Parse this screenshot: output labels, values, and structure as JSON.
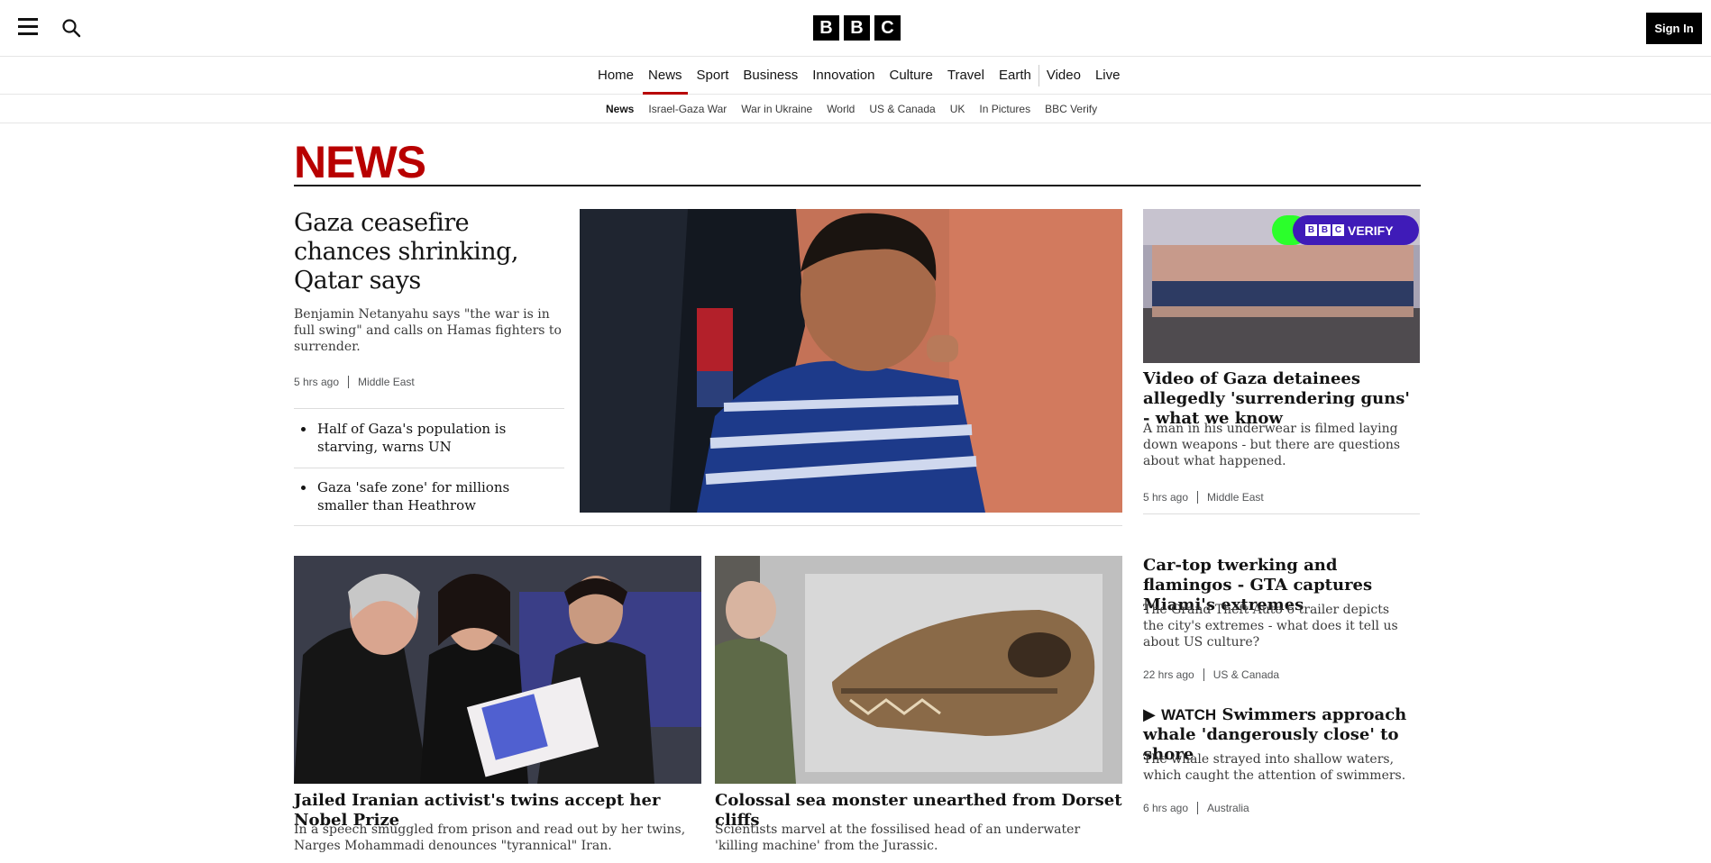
{
  "header": {
    "menu_icon": "hamburger-menu-icon",
    "search_icon": "search-icon",
    "logo_letters": [
      "B",
      "B",
      "C"
    ],
    "signin_label": "Sign In"
  },
  "main_nav": {
    "items": [
      {
        "label": "Home",
        "active": false
      },
      {
        "label": "News",
        "active": true
      },
      {
        "label": "Sport",
        "active": false
      },
      {
        "label": "Business",
        "active": false
      },
      {
        "label": "Innovation",
        "active": false
      },
      {
        "label": "Culture",
        "active": false
      },
      {
        "label": "Travel",
        "active": false
      },
      {
        "label": "Earth",
        "active": false
      },
      {
        "label": "Video",
        "active": false
      },
      {
        "label": "Live",
        "active": false
      }
    ]
  },
  "sub_nav": {
    "items": [
      {
        "label": "News",
        "active": true
      },
      {
        "label": "Israel-Gaza War",
        "active": false
      },
      {
        "label": "War in Ukraine",
        "active": false
      },
      {
        "label": "World",
        "active": false
      },
      {
        "label": "US & Canada",
        "active": false
      },
      {
        "label": "UK",
        "active": false
      },
      {
        "label": "In Pictures",
        "active": false
      },
      {
        "label": "BBC Verify",
        "active": false
      }
    ]
  },
  "section_title": "NEWS",
  "lead": {
    "headline": "Gaza ceasefire chances shrinking, Qatar says",
    "summary": "Benjamin Netanyahu says \"the war is in full swing\" and calls on Hamas fighters to surrender.",
    "time": "5 hrs ago",
    "category": "Middle East",
    "related": [
      "Half of Gaza's population is starving, warns UN",
      "Gaza 'safe zone' for millions smaller than Heathrow"
    ]
  },
  "right_column": {
    "verify_badge": "VERIFY",
    "story1": {
      "headline": "Video of Gaza detainees allegedly 'surrendering guns' - what we know",
      "summary": "A man in his underwear is filmed laying down weapons - but there are questions about what happened.",
      "time": "5 hrs ago",
      "category": "Middle East"
    },
    "story2": {
      "headline": "Car-top twerking and flamingos - GTA captures Miami's extremes",
      "summary": "The Grand Theft Auto 6 trailer depicts the city's extremes - what does it tell us about US culture?",
      "time": "22 hrs ago",
      "category": "US & Canada"
    },
    "story3": {
      "watch_label": "WATCH",
      "headline": "Swimmers approach whale 'dangerously close' to shore",
      "summary": "The whale strayed into shallow waters, which caught the attention of swimmers.",
      "time": "6 hrs ago",
      "category": "Australia"
    }
  },
  "cards": [
    {
      "headline": "Jailed Iranian activist's twins accept her Nobel Prize",
      "summary": "In a speech smuggled from prison and read out by her twins, Narges Mohammadi denounces \"tyrannical\" Iran."
    },
    {
      "headline": "Colossal sea monster unearthed from Dorset cliffs",
      "summary": "Scientists marvel at the fossilised head of an underwater 'killing machine' from the Jurassic."
    }
  ],
  "colors": {
    "brand_red": "#b80000",
    "verify_purple": "#3f1bb8",
    "verify_green": "#2bff2b"
  }
}
